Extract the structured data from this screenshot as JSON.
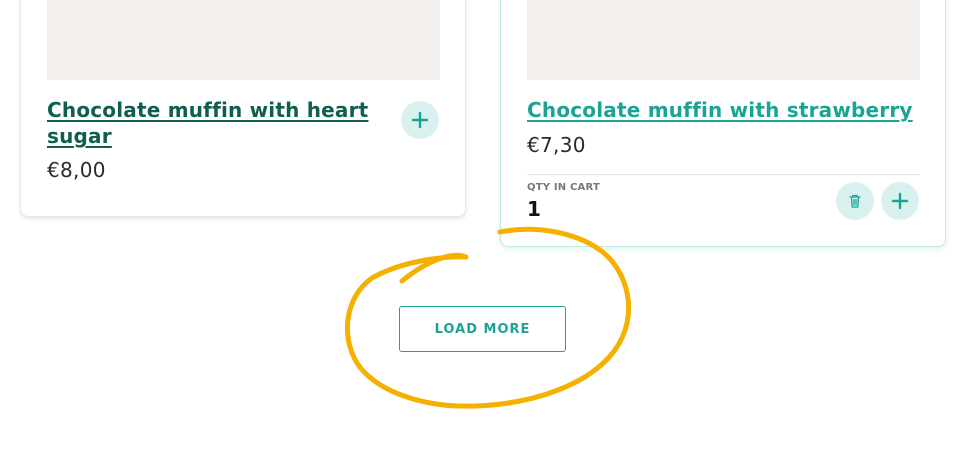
{
  "products": [
    {
      "title": "Chocolate muffin with heart sugar",
      "price": "€8,00",
      "add_icon": "plus-icon"
    },
    {
      "title": "Chocolate muffin with strawberry",
      "price": "€7,30",
      "qty_label": "QTY IN CART",
      "qty_value": "1",
      "remove_icon": "trash-icon",
      "add_icon": "plus-icon"
    }
  ],
  "load_more": {
    "label": "LOAD MORE"
  },
  "colors": {
    "accent": "#1ba394",
    "title_dark": "#0f5e4e",
    "button_bg": "#d9f1ee",
    "image_placeholder": "#f3efec",
    "annotation": "#f5b000"
  }
}
